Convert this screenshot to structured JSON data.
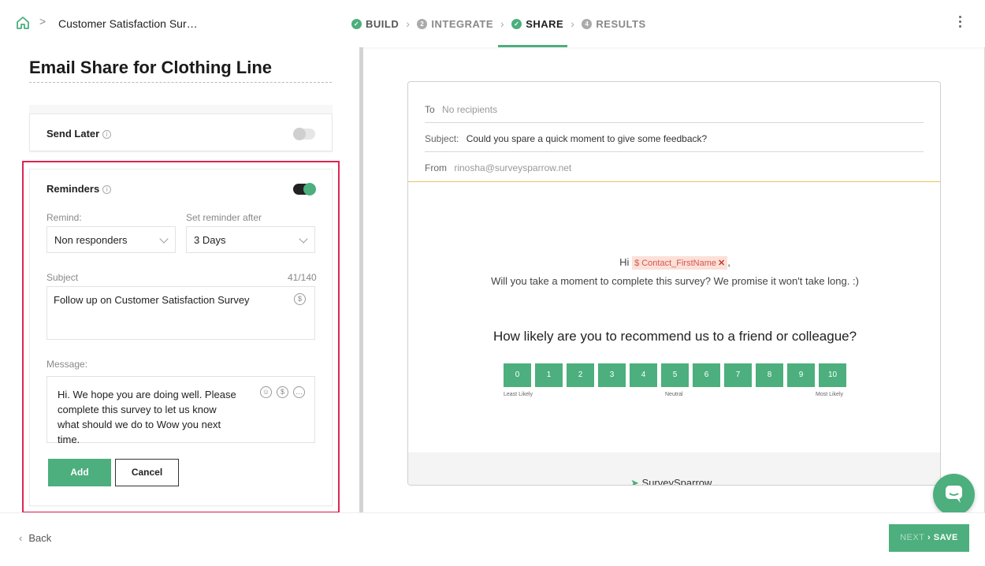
{
  "topbar": {
    "survey_title": "Customer Satisfaction Sur…",
    "separator": ">",
    "steps": [
      {
        "label": "BUILD",
        "state": "done"
      },
      {
        "label": "INTEGRATE",
        "state": "numbered",
        "number": "2"
      },
      {
        "label": "SHARE",
        "state": "active"
      },
      {
        "label": "RESULTS",
        "state": "numbered",
        "number": "4"
      }
    ]
  },
  "left": {
    "page_title": "Email Share for Clothing Line",
    "send_later": {
      "label": "Send Later",
      "enabled": false
    },
    "reminders": {
      "label": "Reminders",
      "enabled": true,
      "remind_label": "Remind:",
      "remind_value": "Non responders",
      "after_label": "Set reminder after",
      "after_value": "3 Days",
      "subject_label": "Subject",
      "subject_count": "41/140",
      "subject_value": "Follow up on Customer Satisfaction Survey",
      "message_label": "Message:",
      "message_value": "Hi. We hope you are doing well. Please complete this survey to let us know what should we do to Wow you next time.",
      "add_label": "Add",
      "cancel_label": "Cancel"
    }
  },
  "preview": {
    "to_label": "To",
    "to_value": "No recipients",
    "subject_label": "Subject:",
    "subject_value": "Could you spare a quick moment to give some feedback?",
    "from_label": "From",
    "from_value": "rinosha@surveysparrow.net",
    "greeting": "Hi",
    "token": "$ Contact_FirstName",
    "body": "Will you take a moment to complete this survey? We promise it won't take long. :)",
    "question": "How likely are you to recommend us to a friend or colleague?",
    "scale": [
      "0",
      "1",
      "2",
      "3",
      "4",
      "5",
      "6",
      "7",
      "8",
      "9",
      "10"
    ],
    "least": "Least Likely",
    "neutral": "Neutral",
    "most": "Most Likely",
    "brand": "SurveySparrow"
  },
  "bottombar": {
    "back_label": "Back",
    "next_label": "NEXT",
    "save_label": "SAVE"
  },
  "colors": {
    "accent": "#4caf7d",
    "highlight": "#e0244f"
  }
}
